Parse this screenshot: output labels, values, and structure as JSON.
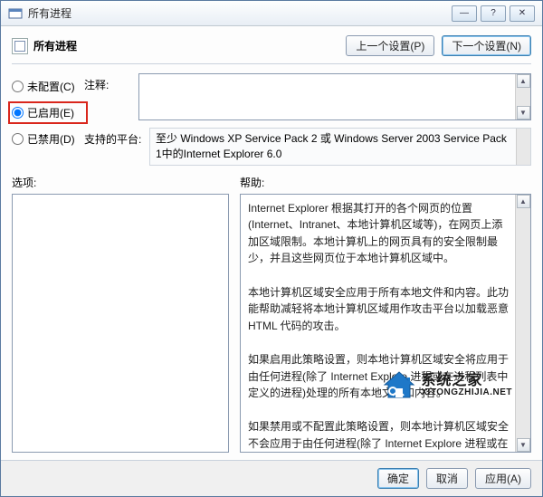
{
  "window": {
    "title": "所有进程"
  },
  "header": {
    "title": "所有进程"
  },
  "nav": {
    "prev": "上一个设置(P)",
    "next": "下一个设置(N)"
  },
  "radios": {
    "not_configured": "未配置(C)",
    "enabled": "已启用(E)",
    "disabled": "已禁用(D)",
    "selected": "enabled"
  },
  "fields": {
    "comment_label": "注释:",
    "comment_value": "",
    "platform_label": "支持的平台:",
    "platform_value": "至少 Windows XP Service Pack 2 或 Windows Server 2003 Service Pack 1中的Internet Explorer 6.0"
  },
  "columns": {
    "options_label": "选项:",
    "help_label": "帮助:"
  },
  "help_text": "Internet Explorer 根据其打开的各个网页的位置(Internet、Intranet、本地计算机区域等)，在网页上添加区域限制。本地计算机上的网页具有的安全限制最少，并且这些网页位于本地计算机区域中。\n\n本地计算机区域安全应用于所有本地文件和内容。此功能帮助减轻将本地计算机区域用作攻击平台以加载恶意 HTML 代码的攻击。\n\n如果启用此策略设置，则本地计算机区域安全将应用于由任何进程(除了 Internet Explore 进程或在进程列表中定义的进程)处理的所有本地文件和内容。\n\n如果禁用或不配置此策略设置，则本地计算机区域安全不会应用于由任何进程(除了 Internet Explore 进程或在进程列表中定义的进程)处理的本地文件和内容。",
  "buttons": {
    "ok": "确定",
    "cancel": "取消",
    "apply": "应用(A)"
  },
  "watermark": {
    "line1": "系统之家",
    "line2": "XITONGZHIJIA.NET"
  }
}
